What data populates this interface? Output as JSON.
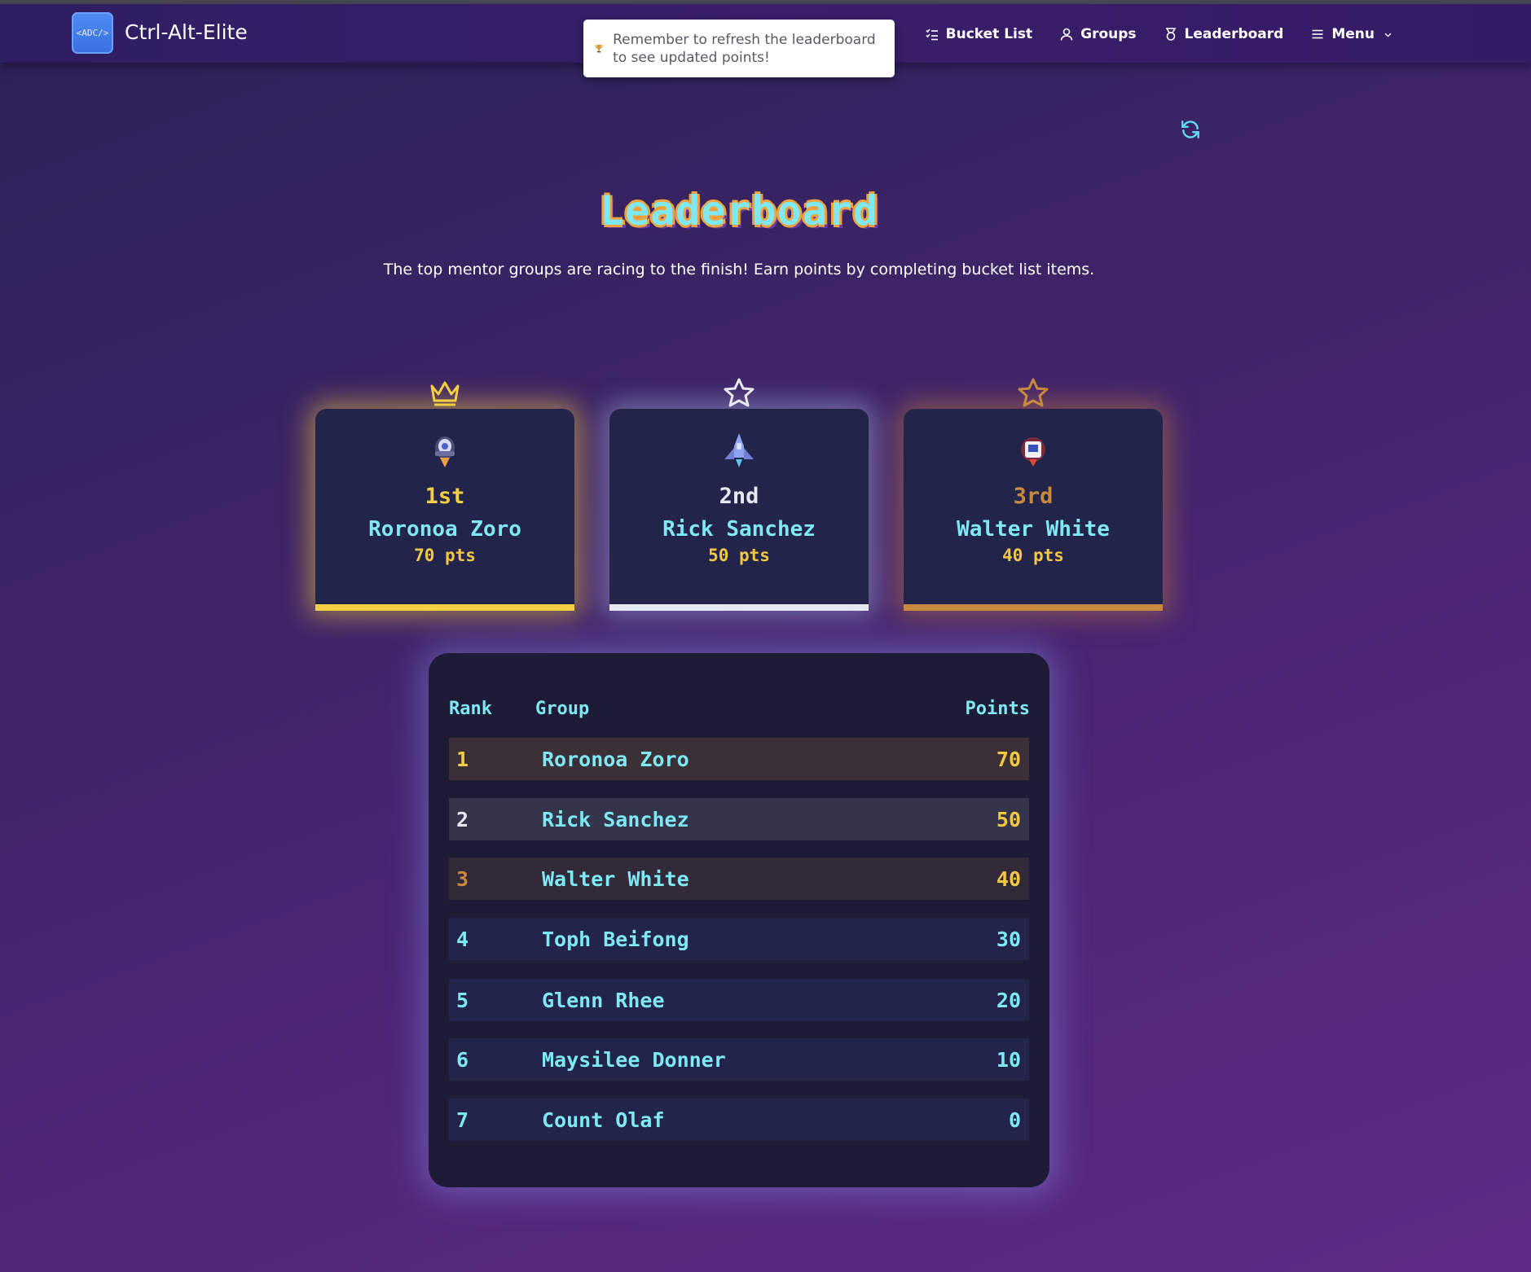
{
  "app": {
    "logo_text": "<ADC/>",
    "brand": "Ctrl-Alt-Elite"
  },
  "nav": {
    "items": [
      {
        "label": "Bucket List",
        "icon": "list-check-icon"
      },
      {
        "label": "Groups",
        "icon": "user-icon"
      },
      {
        "label": "Leaderboard",
        "icon": "medal-icon"
      },
      {
        "label": "Menu",
        "icon": "hamburger-icon"
      }
    ]
  },
  "toast": {
    "icon": "trophy-icon",
    "message": "Remember to refresh the leaderboard to see updated points!"
  },
  "page": {
    "title": "Leaderboard",
    "subtitle": "The top mentor groups are racing to the finish! Earn points by completing bucket list items."
  },
  "podium": [
    {
      "place": "1st",
      "name": "Roronoa Zoro",
      "points": "70 pts",
      "badge": "crown-icon",
      "color": "#f3cf42"
    },
    {
      "place": "2nd",
      "name": "Rick Sanchez",
      "points": "50 pts",
      "badge": "star-icon",
      "color": "#e6e9f2"
    },
    {
      "place": "3rd",
      "name": "Walter White",
      "points": "40 pts",
      "badge": "star-icon",
      "color": "#c98a3f"
    }
  ],
  "table": {
    "headers": {
      "rank": "Rank",
      "group": "Group",
      "points": "Points"
    },
    "rows": [
      {
        "rank": "1",
        "group": "Roronoa Zoro",
        "points": "70"
      },
      {
        "rank": "2",
        "group": "Rick Sanchez",
        "points": "50"
      },
      {
        "rank": "3",
        "group": "Walter White",
        "points": "40"
      },
      {
        "rank": "4",
        "group": "Toph Beifong",
        "points": "30"
      },
      {
        "rank": "5",
        "group": "Glenn Rhee",
        "points": "20"
      },
      {
        "rank": "6",
        "group": "Maysilee Donner",
        "points": "10"
      },
      {
        "rank": "7",
        "group": "Count Olaf",
        "points": "0"
      }
    ]
  }
}
